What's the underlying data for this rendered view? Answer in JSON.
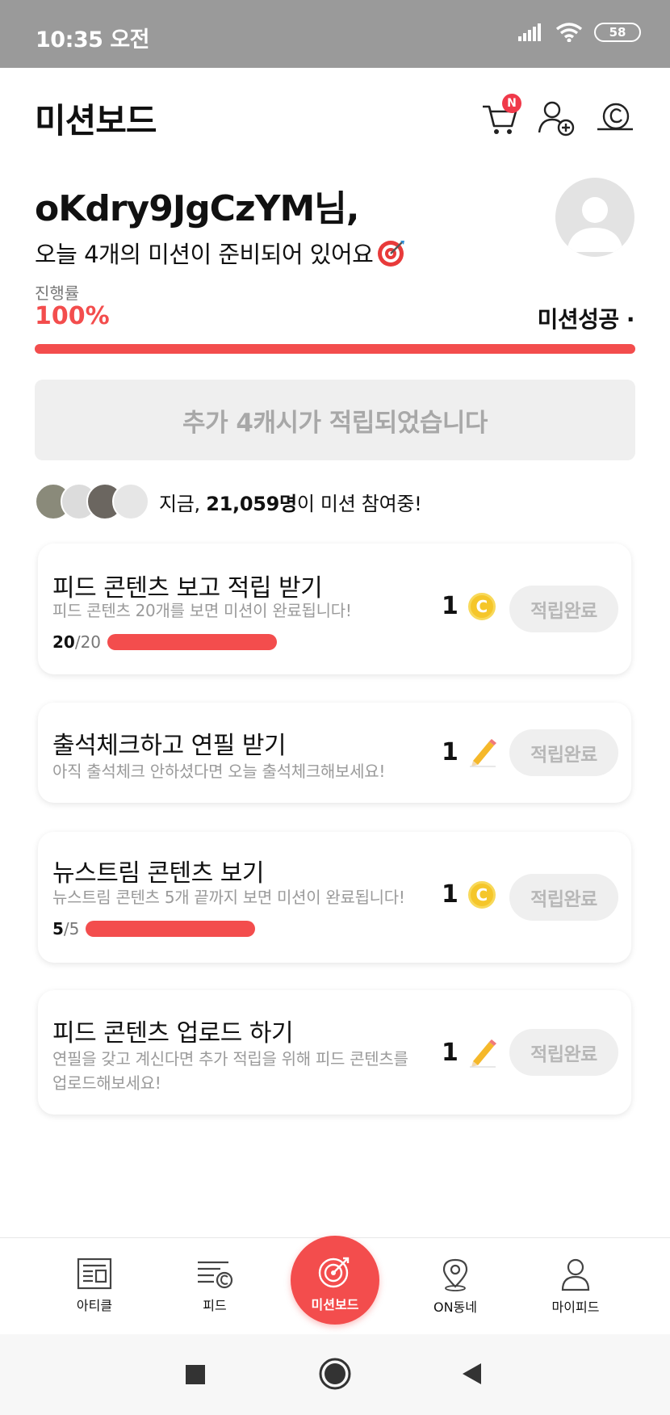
{
  "status_bar": {
    "time": "10:35 오전",
    "battery": "58"
  },
  "header": {
    "title": "미션보드",
    "cart_badge": "N"
  },
  "greeting": {
    "username": "oKdry9JgCzYM님,",
    "subtitle": "오늘 4개의 미션이 준비되어 있어요"
  },
  "progress": {
    "label": "진행률",
    "value": "100%",
    "fraction": 1.0,
    "status": "미션성공 ·",
    "accent_color": "#f34d4d"
  },
  "banner": {
    "text": "추가 4캐시가 적립되었습니다"
  },
  "participants": {
    "prefix": "지금, ",
    "count": "21,059명",
    "suffix": "이 미션 참여중!"
  },
  "missions": [
    {
      "title": "피드 콘텐츠 보고 적립 받기",
      "description": "피드 콘텐츠 20개를 보면 미션이 완료됩니다!",
      "progress_done": "20",
      "progress_total": "/20",
      "reward": "1",
      "reward_icon": "coin-icon",
      "button": "적립완료"
    },
    {
      "title": "출석체크하고 연필 받기",
      "description": "아직 출석체크 안하셨다면 오늘 출석체크해보세요!",
      "reward": "1",
      "reward_icon": "pencil-icon",
      "button": "적립완료"
    },
    {
      "title": "뉴스트림 콘텐츠 보기",
      "description": "뉴스트림 콘텐츠 5개 끝까지 보면 미션이 완료됩니다!",
      "progress_done": "5",
      "progress_total": "/5",
      "reward": "1",
      "reward_icon": "coin-icon",
      "button": "적립완료"
    },
    {
      "title": "피드 콘텐츠 업로드 하기",
      "description": "연필을 갖고 계신다면 추가 적립을 위해 피드 콘텐츠를 업로드해보세요!",
      "reward": "1",
      "reward_icon": "pencil-icon",
      "button": "적립완료"
    }
  ],
  "bottom_nav": {
    "items": [
      {
        "label": "아티클",
        "icon": "article-icon"
      },
      {
        "label": "피드",
        "icon": "feed-icon"
      },
      {
        "label": "미션보드",
        "icon": "target-icon"
      },
      {
        "label": "ON동네",
        "icon": "location-pin-icon"
      },
      {
        "label": "마이피드",
        "icon": "person-icon"
      }
    ]
  }
}
